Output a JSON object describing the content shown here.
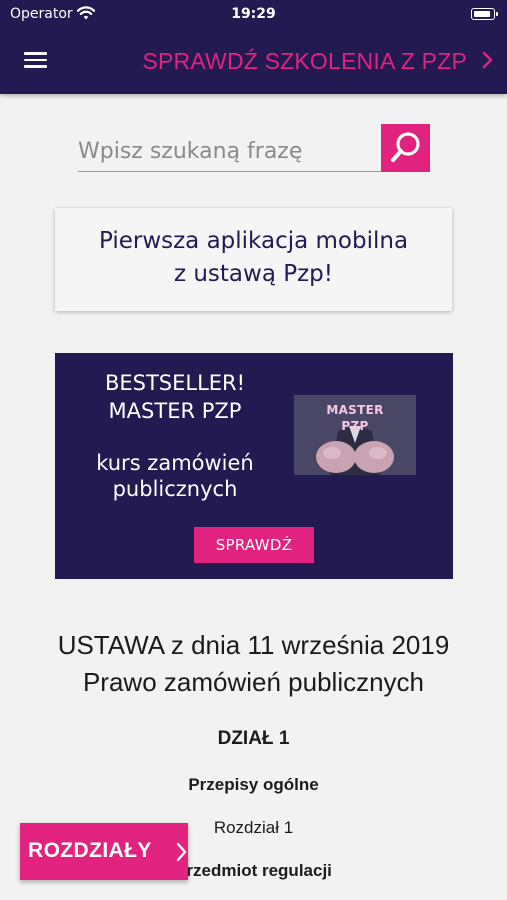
{
  "status_bar": {
    "carrier": "Operator",
    "time": "19:29",
    "battery_level": 0.95
  },
  "nav_bar": {
    "link_label": "SPRAWDŹ SZKOLENIA Z PZP"
  },
  "search": {
    "placeholder": "Wpisz szukaną frazę",
    "value": ""
  },
  "promo_card": {
    "line1": "Pierwsza aplikacja mobilna",
    "line2": "z ustawą Pzp!"
  },
  "banner": {
    "headline1": "BESTSELLER!",
    "headline2": "MASTER PZP",
    "desc1": "kurs zamówień",
    "desc2": "publicznych",
    "button_label": "SPRAWDŹ",
    "image_text1": "MASTER",
    "image_text2": "PZP"
  },
  "document": {
    "title1": "USTAWA z dnia 11 września 2019",
    "title2": "Prawo zamówień publicznych",
    "section": "DZIAŁ 1",
    "subsection": "Przepisy ogólne",
    "chapter": "Rozdział 1",
    "chapter_title": "Przedmiot regulacji"
  },
  "fab": {
    "label": "ROZDZIAŁY"
  },
  "colors": {
    "navy": "#231a52",
    "accent": "#e2227f",
    "background": "#f2f2f2"
  }
}
